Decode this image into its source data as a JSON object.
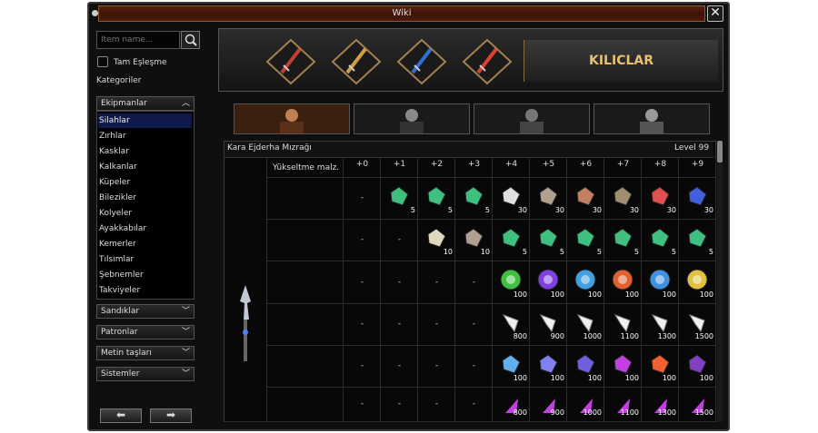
{
  "window": {
    "title": "Wiki",
    "close_label": "✕"
  },
  "sidebar": {
    "search_placeholder": "Item name...",
    "exact_match_label": "Tam Eşleşme",
    "categories_label": "Kategoriler",
    "group_equipment": "Ekipmanlar",
    "items": [
      "Silahlar",
      "Zırhlar",
      "Kasklar",
      "Kalkanlar",
      "Küpeler",
      "Bilezikler",
      "Kolyeler",
      "Ayakkabılar",
      "Kemerler",
      "Tılsımlar",
      "Şebnemler",
      "Takviyeler"
    ],
    "groups": [
      "Sandıklar",
      "Patronlar",
      "Metin taşları",
      "Sistemler"
    ],
    "prev_label": "⬅",
    "next_label": "➡"
  },
  "banner": {
    "title": "KILICLAR"
  },
  "table": {
    "item_name": "Kara Ejderha Mızrağı",
    "level": "Level 99",
    "upgrade_header": "Yükseltme malz.",
    "columns": [
      "+0",
      "+1",
      "+2",
      "+3",
      "+4",
      "+5",
      "+6",
      "+7",
      "+8",
      "+9"
    ],
    "rows": [
      {
        "cells": [
          "-",
          "5",
          "5",
          "5",
          "30",
          "30",
          "30",
          "30",
          "30",
          "30"
        ]
      },
      {
        "cells": [
          "-",
          "-",
          "10",
          "10",
          "5",
          "5",
          "5",
          "5",
          "5",
          "5"
        ]
      },
      {
        "cells": [
          "-",
          "-",
          "-",
          "-",
          "100",
          "100",
          "100",
          "100",
          "100",
          "100"
        ]
      },
      {
        "cells": [
          "-",
          "-",
          "-",
          "-",
          "800",
          "900",
          "1000",
          "1100",
          "1300",
          "1500"
        ]
      },
      {
        "cells": [
          "-",
          "-",
          "-",
          "-",
          "100",
          "100",
          "100",
          "100",
          "100",
          "100"
        ]
      },
      {
        "cells": [
          "-",
          "-",
          "-",
          "-",
          "800",
          "900",
          "1000",
          "1100",
          "1300",
          "1500"
        ]
      }
    ]
  },
  "colors": {
    "title_bar": "#4a1a0a",
    "banner_text": "#e8c070",
    "selected": "#101a4a"
  }
}
